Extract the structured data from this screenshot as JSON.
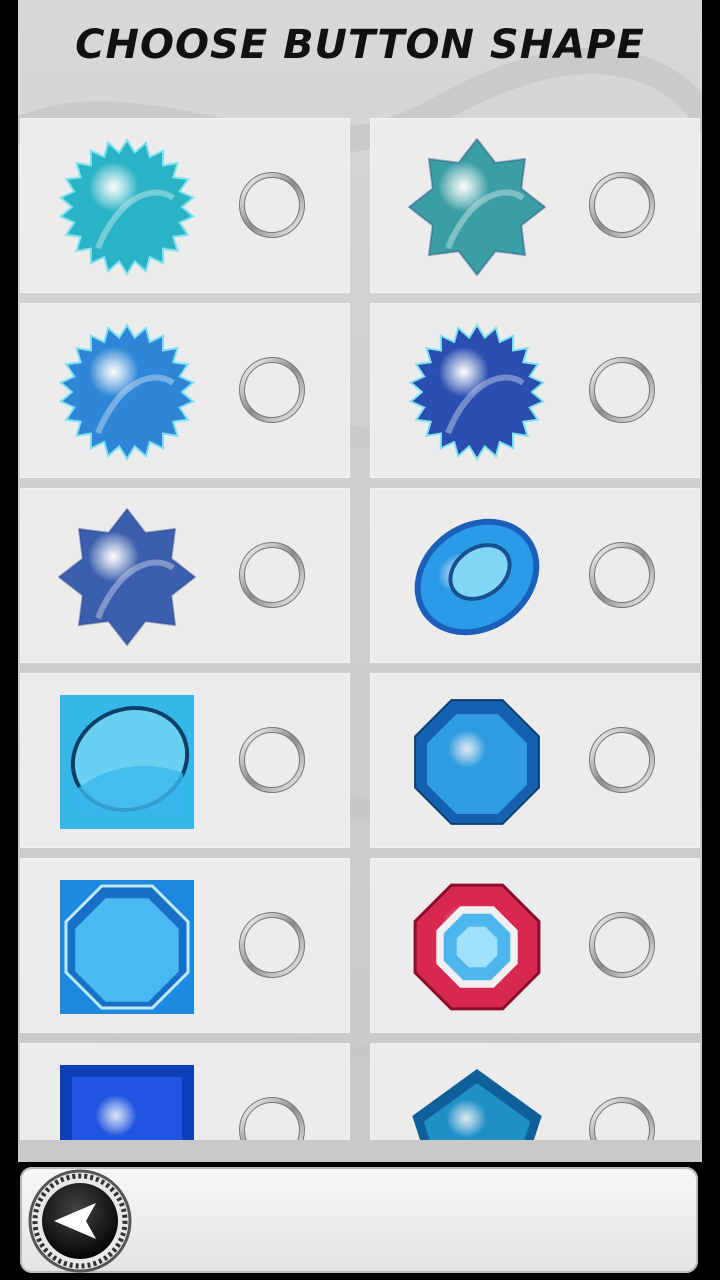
{
  "title": "CHOOSE BUTTON SHAPE",
  "shapes": [
    {
      "icon": "teal-sunburst-icon",
      "color": "#2ab3c4",
      "selected": false
    },
    {
      "icon": "teal-star-icon",
      "color": "#3a9ea4",
      "selected": false
    },
    {
      "icon": "blue-sunburst-icon",
      "color": "#2f86d6",
      "selected": false
    },
    {
      "icon": "navy-sunburst-icon",
      "color": "#2a4fb0",
      "selected": false
    },
    {
      "icon": "blue-star-icon",
      "color": "#3b5fae",
      "selected": false
    },
    {
      "icon": "blue-oval-gem-icon",
      "color": "#2a9be6",
      "selected": false
    },
    {
      "icon": "square-oval-gem-icon",
      "color": "#35b8e8",
      "selected": false
    },
    {
      "icon": "blue-octagon-gem-icon",
      "color": "#2f9de0",
      "selected": false
    },
    {
      "icon": "square-octagon-gem-icon",
      "color": "#1d8ae0",
      "selected": false
    },
    {
      "icon": "red-octagon-gem-icon",
      "color": "#d8284f",
      "selected": false
    },
    {
      "icon": "blue-square-gem-icon",
      "color": "#1f55e0",
      "selected": false
    },
    {
      "icon": "teal-pentagon-gem-icon",
      "color": "#1f90c6",
      "selected": false
    }
  ],
  "back_icon": "back-arrow-icon"
}
